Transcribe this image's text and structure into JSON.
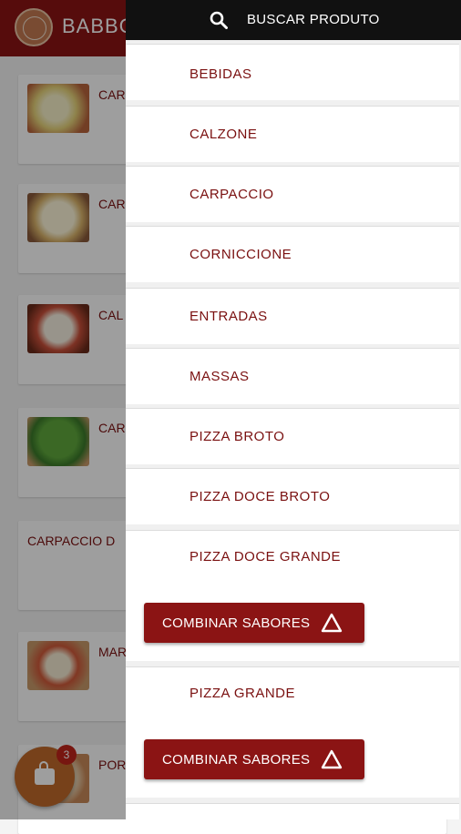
{
  "app": {
    "brand": "BABBO"
  },
  "background_items": [
    {
      "title": "CAR"
    },
    {
      "title": "CAR"
    },
    {
      "title": "CAL"
    },
    {
      "title": "CAR"
    },
    {
      "title": "CARPACCIO D"
    },
    {
      "title": "MAR"
    },
    {
      "title": "POR"
    }
  ],
  "cart": {
    "count": "3"
  },
  "drawer": {
    "search_label": "BUSCAR PRODUTO",
    "categories": [
      {
        "label": "BEBIDAS"
      },
      {
        "label": "CALZONE"
      },
      {
        "label": "CARPACCIO"
      },
      {
        "label": "CORNICCIONE"
      },
      {
        "label": "ENTRADAS"
      },
      {
        "label": "MASSAS"
      },
      {
        "label": "PIZZA BROTO"
      },
      {
        "label": "PIZZA DOCE BROTO"
      },
      {
        "label": "PIZZA DOCE GRANDE",
        "button": "COMBINAR SABORES"
      },
      {
        "label": "PIZZA GRANDE",
        "button": "COMBINAR SABORES"
      }
    ]
  },
  "colors": {
    "primary": "#8b1414",
    "search_bar": "#111111",
    "cart": "#c06a2a"
  }
}
